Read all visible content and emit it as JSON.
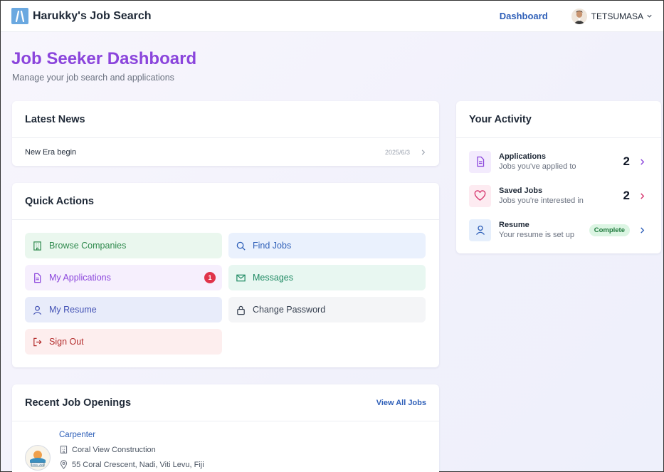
{
  "navbar": {
    "brand": "Harukky's Job Search",
    "dashboard_link": "Dashboard",
    "user_name": "TETSUMASA"
  },
  "header": {
    "title": "Job Seeker Dashboard",
    "subtitle": "Manage your job search and applications"
  },
  "news": {
    "title": "Latest News",
    "items": [
      {
        "headline": "New Era begin",
        "date": "2025/6/3"
      }
    ]
  },
  "quick_actions": {
    "title": "Quick Actions",
    "items": [
      {
        "label": "Browse Companies",
        "icon": "building-icon",
        "color": "#2f8a4d",
        "bg": "#eaf7ee"
      },
      {
        "label": "Find Jobs",
        "icon": "search-icon",
        "color": "#2e5fb8",
        "bg": "#eaf1fd"
      },
      {
        "label": "My Applications",
        "icon": "document-icon",
        "color": "#8b45dc",
        "bg": "#f6effd",
        "badge": "1"
      },
      {
        "label": "Messages",
        "icon": "mail-icon",
        "color": "#1f8a63",
        "bg": "#e8f7f1"
      },
      {
        "label": "My Resume",
        "icon": "user-icon",
        "color": "#4453b5",
        "bg": "#e8ecfa"
      },
      {
        "label": "Change Password",
        "icon": "lock-icon",
        "color": "#374151",
        "bg": "#f4f5f7"
      },
      {
        "label": "Sign Out",
        "icon": "sign-out-icon",
        "color": "#b42e2e",
        "bg": "#fdeeee"
      }
    ]
  },
  "recent_jobs": {
    "title": "Recent Job Openings",
    "view_all": "View All Jobs",
    "items": [
      {
        "title": "Carpenter",
        "company": "Coral View Construction",
        "location": "55 Coral Crescent, Nadi, Viti Levu, Fiji",
        "logo_text": "CORAL VIEW"
      }
    ]
  },
  "activity": {
    "title": "Your Activity",
    "items": [
      {
        "title": "Applications",
        "subtitle": "Jobs you've applied to",
        "count": "2",
        "icon": "document-icon",
        "color": "#8b45dc",
        "bg": "#f3ebfd"
      },
      {
        "title": "Saved Jobs",
        "subtitle": "Jobs you're interested in",
        "count": "2",
        "icon": "heart-icon",
        "color": "#d6336c",
        "bg": "#fdebf1"
      },
      {
        "title": "Resume",
        "subtitle": "Your resume is set up",
        "status": "Complete",
        "icon": "user-icon",
        "color": "#2e5fb8",
        "bg": "#e6effc"
      }
    ]
  }
}
